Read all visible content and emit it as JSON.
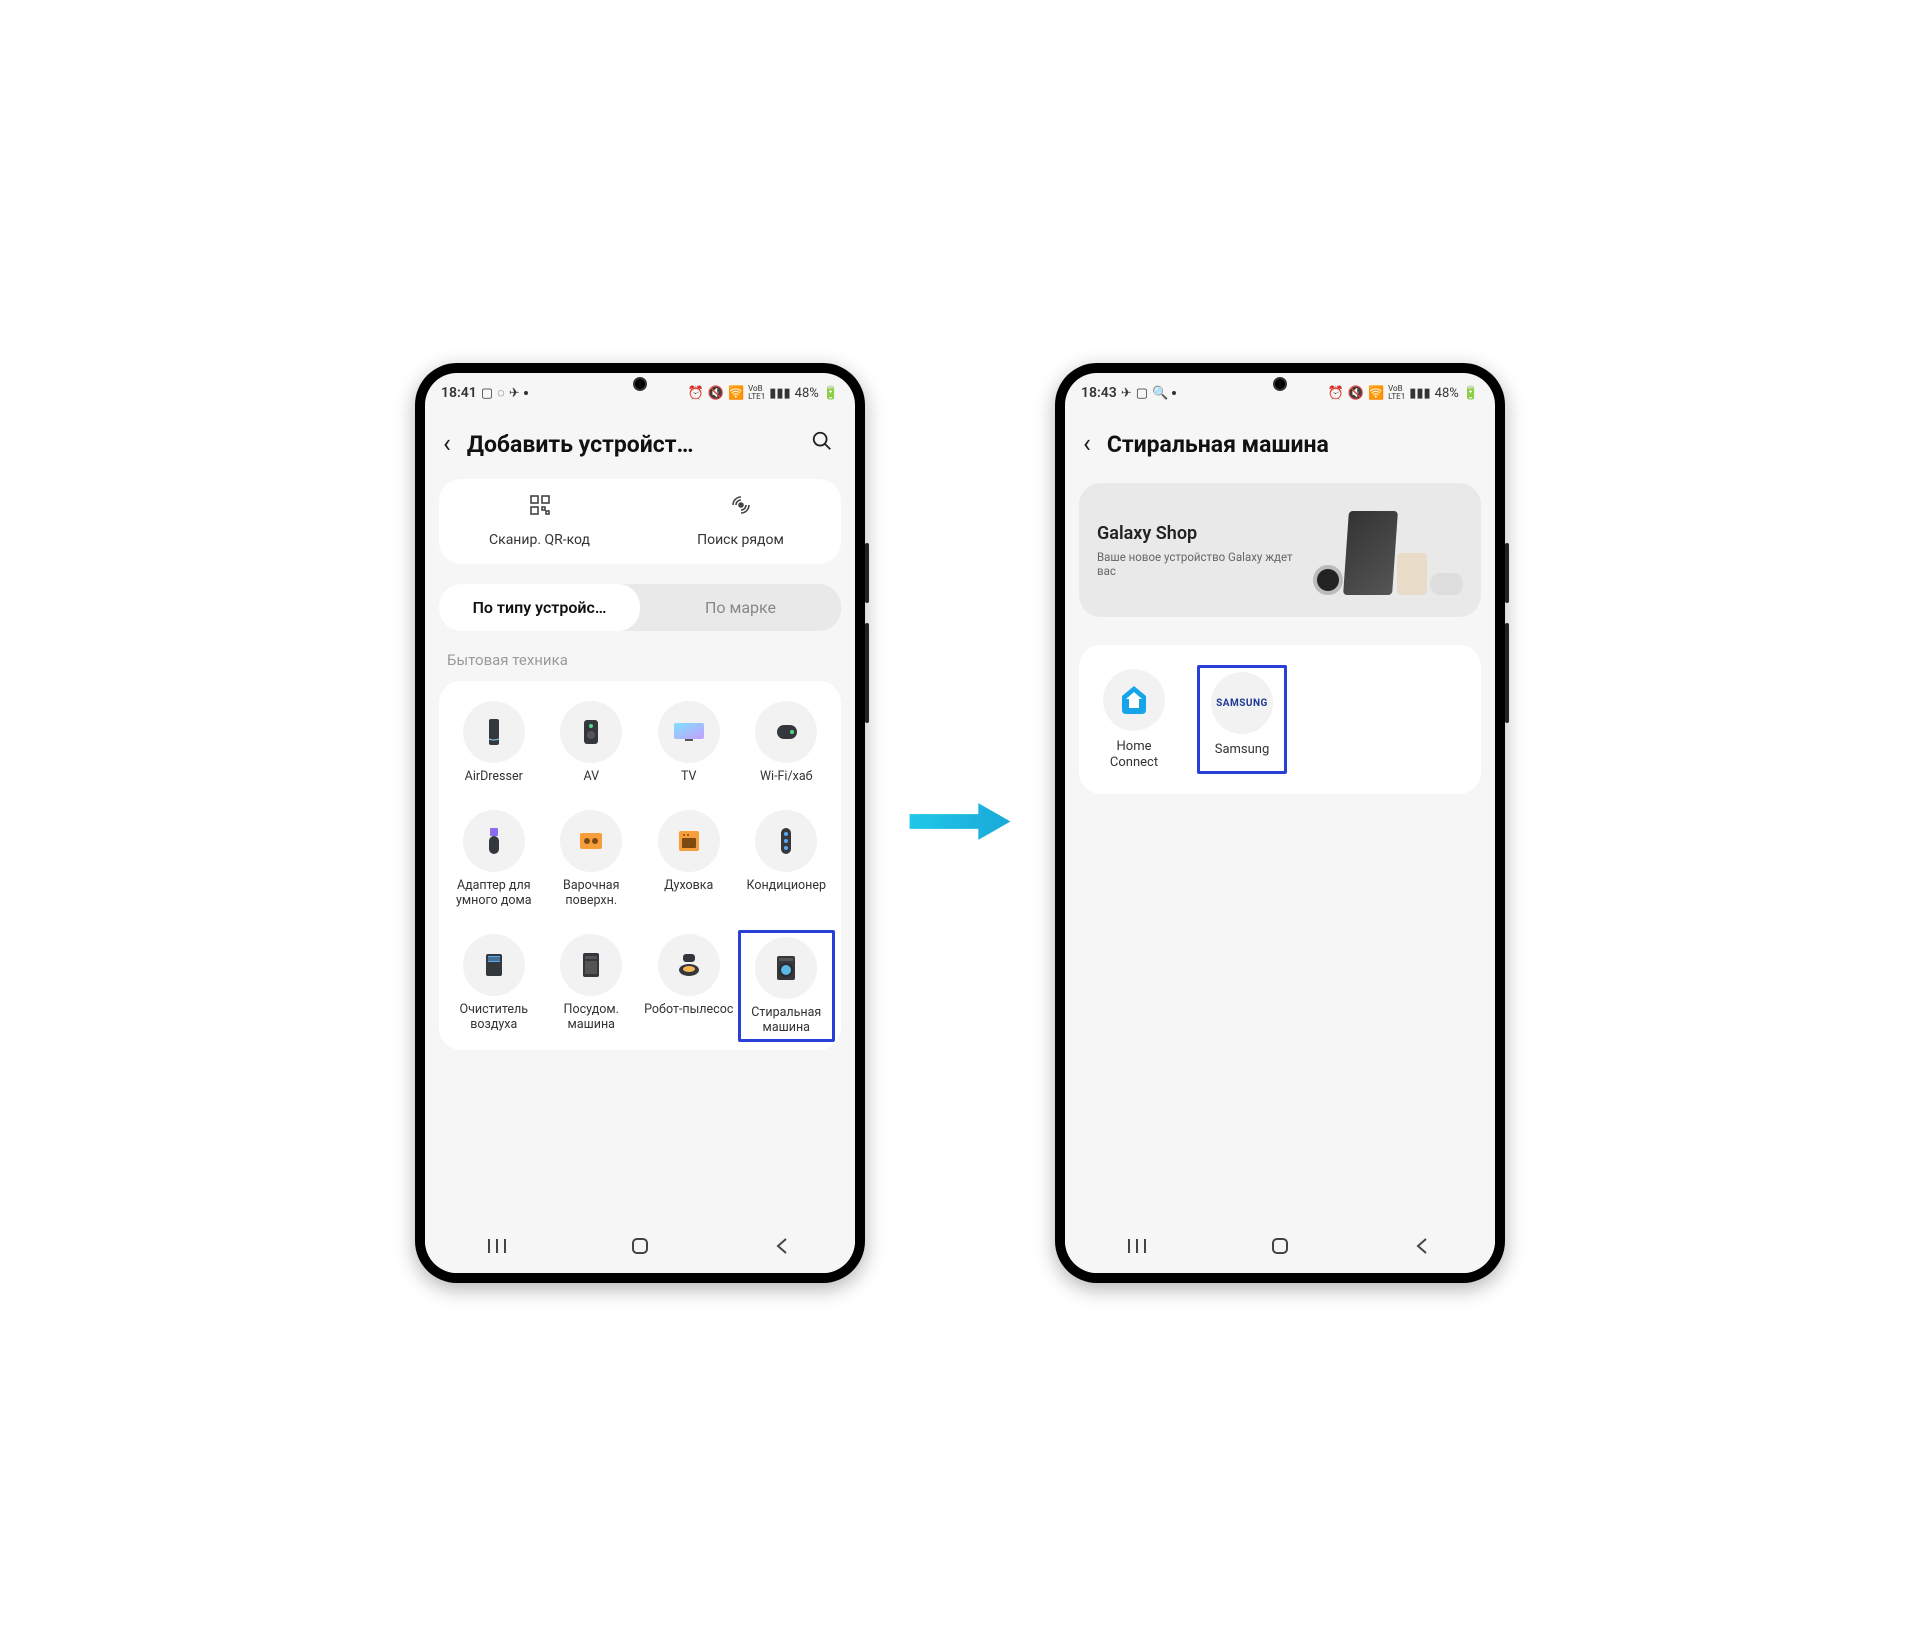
{
  "phone1": {
    "status": {
      "time": "18:41",
      "battery": "48%"
    },
    "header": {
      "title": "Добавить устройст…"
    },
    "top_actions": {
      "qr_label": "Сканир. QR‑код",
      "nearby_label": "Поиск рядом"
    },
    "tabs": {
      "by_type": "По типу устройс…",
      "by_brand": "По марке"
    },
    "section_label": "Бытовая техника",
    "devices": [
      {
        "label": "AirDresser"
      },
      {
        "label": "AV"
      },
      {
        "label": "TV"
      },
      {
        "label": "Wi‑Fi/хаб"
      },
      {
        "label": "Адаптер для умного дома"
      },
      {
        "label": "Варочная поверхн."
      },
      {
        "label": "Духовка"
      },
      {
        "label": "Кондиционер"
      },
      {
        "label": "Очиститель воздуха"
      },
      {
        "label": "Посудом. машина"
      },
      {
        "label": "Робот‑пылесос"
      },
      {
        "label": "Стиральная машина"
      }
    ]
  },
  "phone2": {
    "status": {
      "time": "18:43",
      "battery": "48%"
    },
    "header": {
      "title": "Стиральная машина"
    },
    "promo": {
      "title": "Galaxy Shop",
      "subtitle": "Ваше новое устройство Galaxy ждет вас"
    },
    "brands": [
      {
        "label": "Home Connect",
        "logo_text": ""
      },
      {
        "label": "Samsung",
        "logo_text": "SAMSUNG"
      }
    ]
  }
}
